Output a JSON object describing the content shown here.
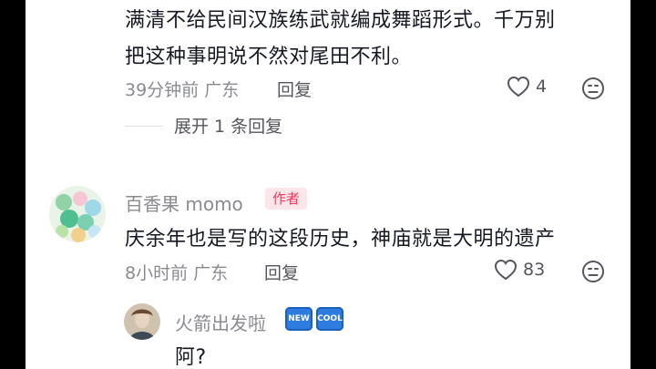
{
  "comment1": {
    "line1": "满清不给民间汉族练武就编成舞蹈形式。千万别",
    "line2": "把这种事明说不然对尾田不利。",
    "meta": "39分钟前 广东",
    "reply_label": "回复",
    "likes": "4",
    "expand_label": "展开 1 条回复"
  },
  "comment2": {
    "author": "百香果 momo",
    "author_tag": "作者",
    "text": "庆余年也是写的这段历史，神庙就是大明的遗产",
    "meta": "8小时前 广东",
    "reply_label": "回复",
    "likes": "83"
  },
  "reply1": {
    "author": "火箭出发啦",
    "badges": [
      "NEW",
      "COOL"
    ],
    "text": "阿?"
  },
  "colors": {
    "author_tag_bg": "#fde6ea",
    "author_tag_text": "#f3385d",
    "badge_blue": "#2f7ce0"
  }
}
